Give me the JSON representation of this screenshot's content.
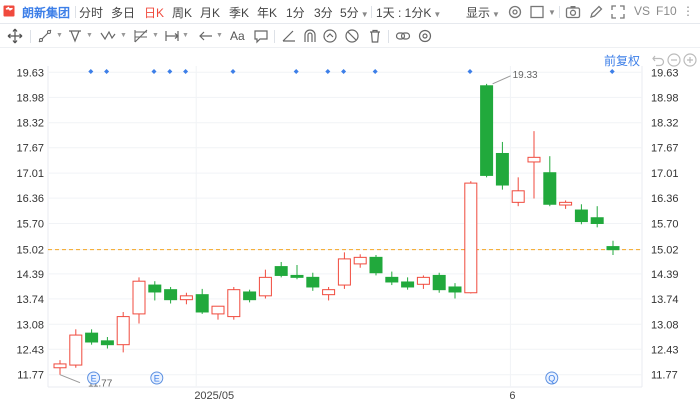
{
  "toolbar": {
    "stock_name": "朗新集团",
    "periods": [
      "分时",
      "多日",
      "日K",
      "周K",
      "月K",
      "季K",
      "年K",
      "1分",
      "3分"
    ],
    "active_period": "日K",
    "min_select": "5分",
    "multi_select": "1天 : 1分K",
    "display_label": "显示",
    "vs_label": "VS",
    "f10_label": "F10"
  },
  "drawing_tools": {
    "text_tool_label": "Aa"
  },
  "chart_panel": {
    "adjust_label": "前复权",
    "price_line_label": "15.02",
    "high_label": "19.33",
    "low_label": "11.77",
    "x_ticks": [
      "2025/05",
      "6"
    ],
    "event_markers": [
      "E",
      "E",
      "Q"
    ],
    "colors": {
      "up": "#f04a3d",
      "down": "#21a93c",
      "accent": "#3d7fe8",
      "dashed_line": "#f5a623"
    }
  },
  "chart_data": {
    "type": "candlestick",
    "ylim": [
      11.45,
      19.95
    ],
    "y_ticks": [
      19.63,
      18.98,
      18.32,
      17.67,
      17.01,
      16.36,
      15.7,
      15.02,
      14.39,
      13.74,
      13.08,
      12.43,
      11.77
    ],
    "x_labels": [
      "2025/05",
      "6"
    ],
    "current_price": 15.02,
    "high": 19.33,
    "low": 11.77,
    "candles": [
      {
        "o": 11.95,
        "h": 12.15,
        "l": 11.77,
        "c": 12.05
      },
      {
        "o": 12.02,
        "h": 12.95,
        "l": 11.95,
        "c": 12.8
      },
      {
        "o": 12.85,
        "h": 12.95,
        "l": 12.55,
        "c": 12.62
      },
      {
        "o": 12.65,
        "h": 12.75,
        "l": 12.45,
        "c": 12.55
      },
      {
        "o": 12.55,
        "h": 13.4,
        "l": 12.35,
        "c": 13.28
      },
      {
        "o": 13.35,
        "h": 14.3,
        "l": 13.1,
        "c": 14.2
      },
      {
        "o": 14.1,
        "h": 14.2,
        "l": 13.7,
        "c": 13.92
      },
      {
        "o": 13.98,
        "h": 14.05,
        "l": 13.62,
        "c": 13.72
      },
      {
        "o": 13.72,
        "h": 13.9,
        "l": 13.6,
        "c": 13.82
      },
      {
        "o": 13.85,
        "h": 14.0,
        "l": 13.35,
        "c": 13.4
      },
      {
        "o": 13.35,
        "h": 13.55,
        "l": 13.2,
        "c": 13.55
      },
      {
        "o": 13.28,
        "h": 14.05,
        "l": 13.2,
        "c": 13.98
      },
      {
        "o": 13.92,
        "h": 13.98,
        "l": 13.65,
        "c": 13.72
      },
      {
        "o": 13.82,
        "h": 14.5,
        "l": 13.75,
        "c": 14.3
      },
      {
        "o": 14.58,
        "h": 14.7,
        "l": 14.3,
        "c": 14.35
      },
      {
        "o": 14.35,
        "h": 14.62,
        "l": 14.25,
        "c": 14.3
      },
      {
        "o": 14.3,
        "h": 14.42,
        "l": 13.95,
        "c": 14.05
      },
      {
        "o": 13.85,
        "h": 14.05,
        "l": 13.7,
        "c": 13.98
      },
      {
        "o": 14.1,
        "h": 14.95,
        "l": 14.0,
        "c": 14.78
      },
      {
        "o": 14.65,
        "h": 14.9,
        "l": 14.55,
        "c": 14.82
      },
      {
        "o": 14.82,
        "h": 14.88,
        "l": 14.35,
        "c": 14.42
      },
      {
        "o": 14.3,
        "h": 14.45,
        "l": 14.1,
        "c": 14.18
      },
      {
        "o": 14.18,
        "h": 14.3,
        "l": 13.98,
        "c": 14.05
      },
      {
        "o": 14.12,
        "h": 14.35,
        "l": 14.0,
        "c": 14.3
      },
      {
        "o": 14.35,
        "h": 14.42,
        "l": 13.9,
        "c": 13.98
      },
      {
        "o": 14.05,
        "h": 14.15,
        "l": 13.75,
        "c": 13.92
      },
      {
        "o": 13.9,
        "h": 16.8,
        "l": 13.88,
        "c": 16.75
      },
      {
        "o": 19.28,
        "h": 19.33,
        "l": 16.9,
        "c": 16.95
      },
      {
        "o": 17.52,
        "h": 17.82,
        "l": 16.58,
        "c": 16.7
      },
      {
        "o": 16.25,
        "h": 16.9,
        "l": 16.15,
        "c": 16.55
      },
      {
        "o": 17.3,
        "h": 18.1,
        "l": 16.35,
        "c": 17.42
      },
      {
        "o": 17.02,
        "h": 17.45,
        "l": 16.15,
        "c": 16.2
      },
      {
        "o": 16.18,
        "h": 16.3,
        "l": 16.08,
        "c": 16.25
      },
      {
        "o": 16.05,
        "h": 16.2,
        "l": 15.68,
        "c": 15.75
      },
      {
        "o": 15.85,
        "h": 16.15,
        "l": 15.6,
        "c": 15.7
      },
      {
        "o": 15.1,
        "h": 15.25,
        "l": 14.88,
        "c": 15.02
      }
    ]
  }
}
